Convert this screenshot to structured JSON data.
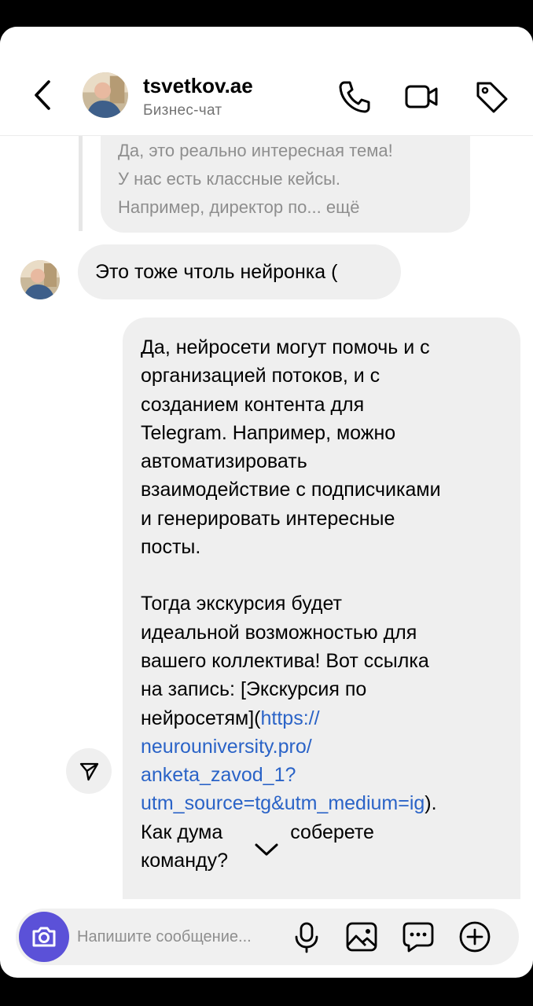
{
  "header": {
    "username": "tsvetkov.ae",
    "subtitle": "Бизнес-чат",
    "icons": [
      "back-arrow-icon",
      "phone-icon",
      "video-call-icon",
      "tag-icon"
    ]
  },
  "messages": {
    "reply_preview": {
      "line1": "Да, это реально интересная тема!",
      "line2": "У нас есть классные кейсы.",
      "line3": "Например, директор по... ещё"
    },
    "incoming": {
      "text": "Это тоже чтоль нейронка ("
    },
    "outgoing": {
      "p1_lines": [
        "Да, нейросети могут помочь и с",
        "организацией потоков, и с",
        "созданием контента для",
        "Telegram. Например, можно",
        "автоматизировать",
        "взаимодействие с подписчиками",
        "и генерировать интересные",
        "посты."
      ],
      "p2_line1": "Тогда экскурсия будет",
      "p2_line2": "идеальной возможностью для",
      "p2_line3": "вашего коллектива! Вот ссылка",
      "p2_line4": "на запись: [Экскурсия по",
      "p2_line5_text": "нейросетям](",
      "link_part1": "https://",
      "link_part2": "neurouniversity.pro/",
      "link_part3": "anketa_zavod_1?",
      "link_part4": "utm_source=tg&utm_medium=ig",
      "link_close": ").",
      "p2_line10_a": "Как дума",
      "p2_line10_b": "соберете",
      "p2_line11": "команду?"
    }
  },
  "composer": {
    "placeholder": "Напишите сообщение...",
    "icons": [
      "camera-icon",
      "microphone-icon",
      "gallery-icon",
      "sticker-icon",
      "plus-icon"
    ]
  },
  "colors": {
    "accent": "#5b51d8",
    "link": "#2a63c7",
    "bubble": "#efefef"
  }
}
